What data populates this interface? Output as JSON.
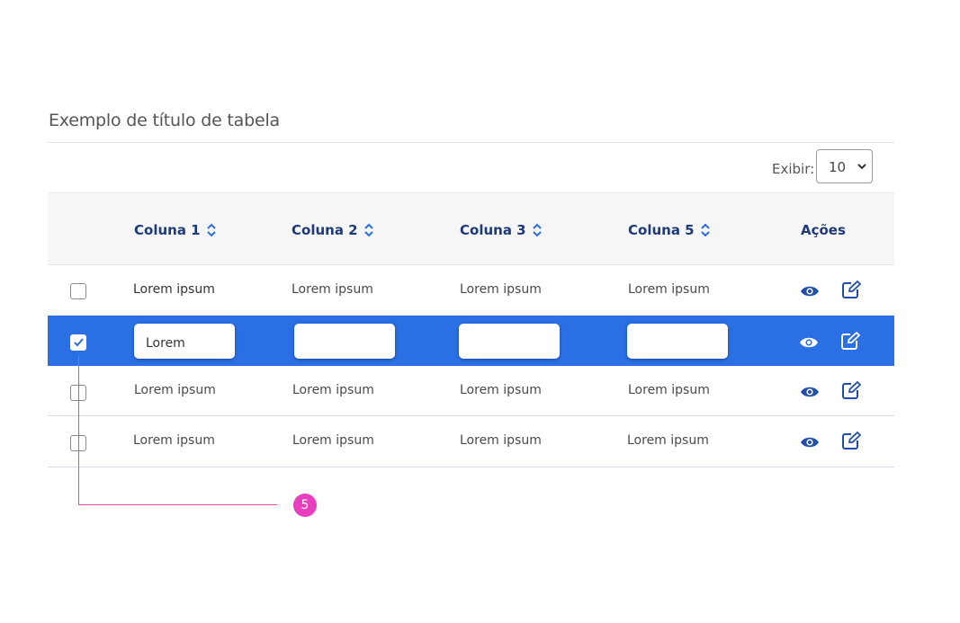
{
  "table": {
    "title": "Exemplo de título de tabela",
    "show_label": "Exibir:",
    "page_size": "10",
    "headers": [
      "Coluna 1",
      "Coluna 2",
      "Coluna 3",
      "Coluna 5",
      "Ações"
    ],
    "rows": [
      {
        "checked": false,
        "cells": [
          "Lorem ipsum",
          "Lorem ipsum",
          "Lorem ipsum",
          "Lorem ipsum"
        ]
      },
      {
        "checked": true,
        "editing": true,
        "inputs": [
          "Lorem",
          "",
          "",
          ""
        ]
      },
      {
        "checked": false,
        "cells": [
          "Lorem ipsum",
          "Lorem ipsum",
          "Lorem ipsum",
          "Lorem ipsum"
        ]
      },
      {
        "checked": false,
        "cells": [
          "Lorem ipsum",
          "Lorem ipsum",
          "Lorem ipsum",
          "Lorem ipsum"
        ]
      }
    ],
    "row_actions": [
      "eye-icon",
      "edit-icon"
    ]
  },
  "annotation": {
    "badge": "5"
  },
  "colors": {
    "accent": "#2a6fe4",
    "header_text": "#1e3a7a",
    "callout": "#e83fbf"
  }
}
